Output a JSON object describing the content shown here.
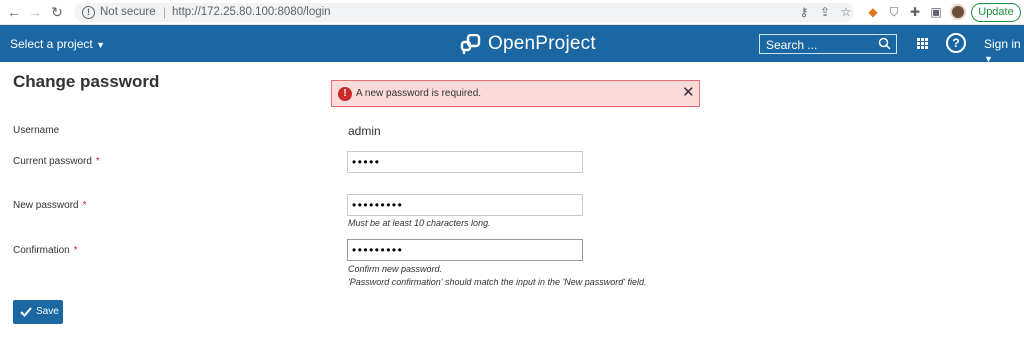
{
  "browser": {
    "security_label": "Not secure",
    "url": "http://172.25.80.100:8080/login",
    "update_label": "Update"
  },
  "header": {
    "project_menu_label": "Select a project",
    "logo_text": "OpenProject",
    "search_placeholder": "Search ...",
    "help_label": "?",
    "signin_label": "Sign in"
  },
  "page": {
    "title": "Change password"
  },
  "flash": {
    "message": "A new password is required.",
    "close_label": "✕"
  },
  "form": {
    "username_label": "Username",
    "username_value": "admin",
    "current_password_label": "Current password",
    "current_password_value": "•••••",
    "new_password_label": "New password",
    "new_password_value": "•••••••••",
    "new_password_hint": "Must be at least 10 characters long.",
    "confirmation_label": "Confirmation",
    "confirmation_value": "•••••••••",
    "confirmation_hint_1": "Confirm new password.",
    "confirmation_hint_2": "'Password confirmation' should match the input in the 'New password' field.",
    "required_marker": "*",
    "save_label": "Save"
  },
  "colors": {
    "header_bg": "#1a67a3",
    "error_bg": "#fbdada",
    "error_border": "#e66e6e",
    "error_icon": "#c92a2a",
    "save_button": "#1a67a3"
  }
}
